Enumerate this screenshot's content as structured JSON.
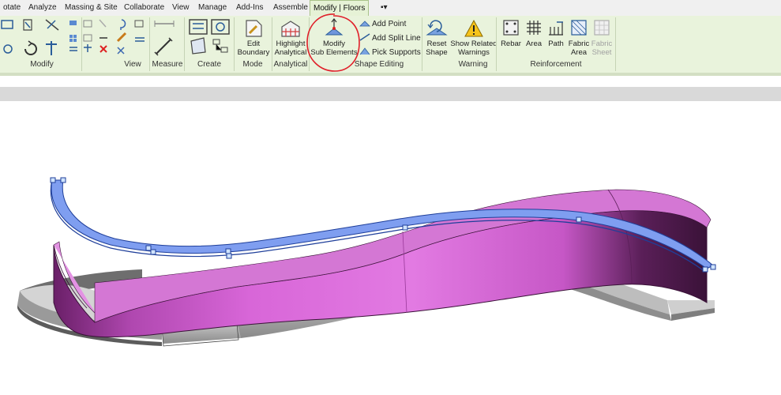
{
  "ribbon_tabs": [
    {
      "label": "otate"
    },
    {
      "label": "Analyze"
    },
    {
      "label": "Massing & Site"
    },
    {
      "label": "Collaborate"
    },
    {
      "label": "View"
    },
    {
      "label": "Manage"
    },
    {
      "label": "Add-Ins"
    },
    {
      "label": "Assemble"
    },
    {
      "label": "Modify | Floors",
      "active": true
    },
    {
      "label": "▪▾"
    }
  ],
  "groups": {
    "modify": "Modify",
    "view": "View",
    "measure": "Measure",
    "create": "Create",
    "mode": "Mode",
    "analytical": "Analytical",
    "shape_editing": "Shape Editing",
    "warning": "Warning",
    "reinforcement": "Reinforcement"
  },
  "buttons": {
    "edit_boundary": [
      "Edit",
      "Boundary"
    ],
    "highlight_analytical": [
      "Highlight",
      "Analytical"
    ],
    "modify_sub_elements": [
      "Modify",
      "Sub Elements"
    ],
    "add_point": "Add Point",
    "add_split_line": "Add Split Line",
    "pick_supports": "Pick Supports",
    "reset_shape": [
      "Reset",
      "Shape"
    ],
    "show_related_warnings": [
      "Show Related",
      "Warnings"
    ],
    "rebar": "Rebar",
    "area": "Area",
    "path": "Path",
    "fabric_area": [
      "Fabric",
      "Area"
    ],
    "fabric_sheet": [
      "Fabric",
      "Sheet"
    ]
  },
  "colors": {
    "ribbon_bg": "#e9f3dc",
    "wall_magenta": "#d866d8",
    "floor_blue": "#7f9ef0",
    "annotation_red": "#e0202a"
  }
}
